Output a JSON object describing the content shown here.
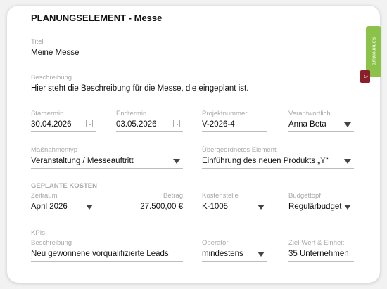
{
  "header": {
    "title": "PLANUNGSELEMENT - Messe"
  },
  "fields": {
    "titel": {
      "label": "Titel",
      "value": "Meine Messe"
    },
    "beschreibung": {
      "label": "Beschreibung",
      "value": "Hier steht die Beschreibung für die Messe, die eingeplant ist."
    },
    "starttermin": {
      "label": "Starttermin",
      "value": "30.04.2026"
    },
    "endtermin": {
      "label": "Endtermin",
      "value": "03.05.2026"
    },
    "projektnummer": {
      "label": "Projektnummer",
      "value": "V-2026-4"
    },
    "verantwortlich": {
      "label": "Verantwortlich",
      "value": "Anna Beta"
    },
    "massnahmentyp": {
      "label": "Maßnahmentyp",
      "value": "Veranstaltung / Messeauftritt"
    },
    "uebergeordnetes": {
      "label": "Übergeordnetes Element",
      "value": "Einführung des neuen Produkts „Y“"
    }
  },
  "kosten": {
    "section_title": "GEPLANTE KOSTEN",
    "zeitraum": {
      "label": "Zeitraum",
      "value": "April 2026"
    },
    "betrag": {
      "label": "Betrag",
      "value": "27.500,00 €"
    },
    "kostenstelle": {
      "label": "Kostenstelle",
      "value": "K-1005"
    },
    "budgettopf": {
      "label": "Budgettopf",
      "value": "Regulärbudget"
    }
  },
  "kpis": {
    "section_title": "KPIs",
    "beschreibung": {
      "label": "Beschreibung",
      "value": "Neu gewonnene vorqualifizierte Leads"
    },
    "operator": {
      "label": "Operator",
      "value": "mindestens"
    },
    "zielwert": {
      "label": "Ziel-Wert & Einheit",
      "value": "35 Unternehmen"
    }
  },
  "sidebar": {
    "comments_label": "Kommentare",
    "comments_count": "3"
  },
  "colors": {
    "accent_green": "#8bc34a",
    "badge_red": "#8b1e2b"
  }
}
